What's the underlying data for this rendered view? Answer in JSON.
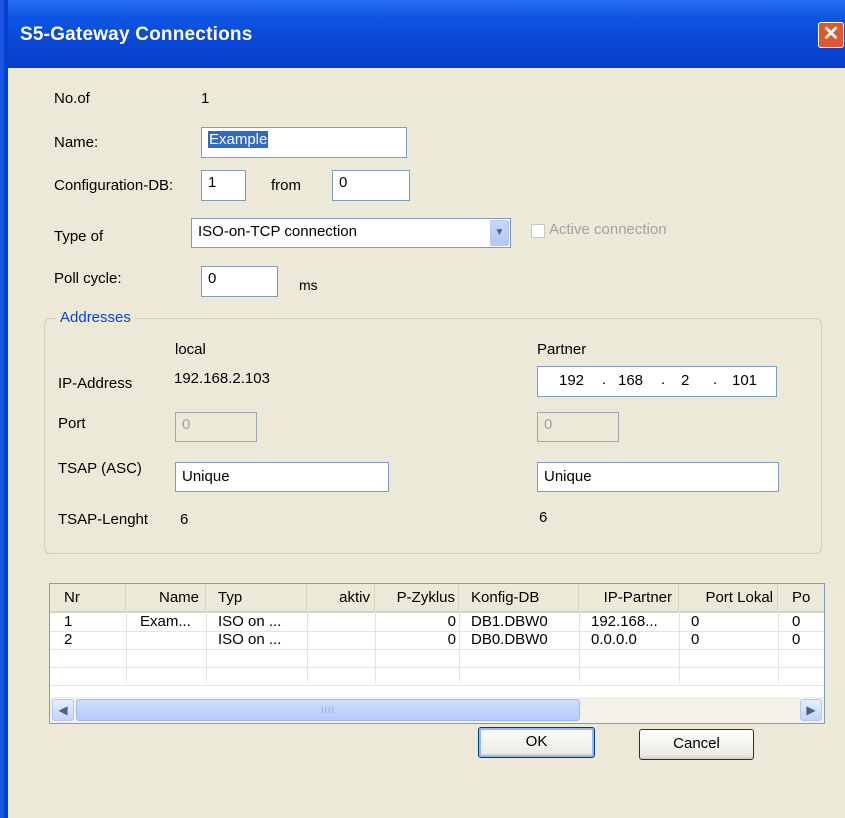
{
  "window": {
    "title": "S5-Gateway Connections",
    "close_icon": "close-icon"
  },
  "form": {
    "no_of_label": "No.of",
    "no_of_value": "1",
    "name_label": "Name:",
    "name_value": "Example",
    "config_db_label": "Configuration-DB:",
    "config_db_value": "1",
    "from_label": "from",
    "from_value": "0",
    "type_label": "Type of",
    "type_value": "ISO-on-TCP connection",
    "active_connection_label": "Active connection",
    "active_connection_checked": false,
    "poll_cycle_label": "Poll cycle:",
    "poll_cycle_value": "0",
    "poll_cycle_unit": "ms"
  },
  "addresses": {
    "group_title": "Addresses",
    "local_header": "local",
    "partner_header": "Partner",
    "ip_label": "IP-Address",
    "local_ip": "192.168.2.103",
    "partner_ip": [
      "192",
      "168",
      "2",
      "101"
    ],
    "port_label": "Port",
    "local_port": "0",
    "partner_port": "0",
    "tsap_label": "TSAP (ASC)",
    "local_tsap": "Unique",
    "partner_tsap": "Unique",
    "tsap_length_label": "TSAP-Lenght",
    "local_tsap_length": "6",
    "partner_tsap_length": "6"
  },
  "table": {
    "columns": [
      "Nr",
      "Name",
      "Typ",
      "aktiv",
      "P-Zyklus",
      "Konfig-DB",
      "IP-Partner",
      "Port Lokal",
      "Po"
    ],
    "rows": [
      [
        "1",
        "Exam...",
        "ISO on ...",
        "",
        "0",
        "DB1.DBW0",
        "192.168...",
        "0",
        "0"
      ],
      [
        "2",
        "",
        "ISO on ...",
        "",
        "0",
        "DB0.DBW0",
        "0.0.0.0",
        "0",
        "0"
      ]
    ],
    "scroll_grip": "IIII"
  },
  "buttons": {
    "ok": "OK",
    "cancel": "Cancel"
  }
}
